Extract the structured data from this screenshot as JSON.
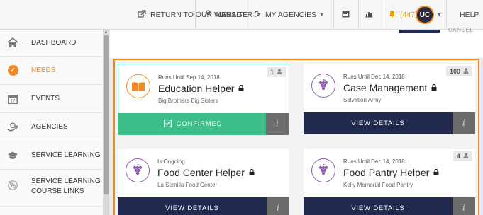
{
  "nav": {
    "return_label": "RETURN TO OUR WEBSITE",
    "manager_label": "MANAGER",
    "my_agencies_label": "MY AGENCIES",
    "alerts_label": "(447)",
    "user_initials": "UC",
    "help_label": "HELP"
  },
  "sidebar": {
    "items": [
      {
        "label": "DASHBOARD",
        "icon": "home-icon"
      },
      {
        "label": "NEEDS",
        "icon": "check-circle-icon",
        "active": true
      },
      {
        "label": "EVENTS",
        "icon": "calendar-icon",
        "day": "17"
      },
      {
        "label": "AGENCIES",
        "icon": "hands-icon"
      },
      {
        "label": "SERVICE LEARNING",
        "icon": "graduation-cap-icon"
      },
      {
        "label": "SERVICE LEARNING COURSE LINKS",
        "label_line1": "SERVICE LEARNING",
        "label_line2": "COURSE LINKS",
        "icon": "link-icon"
      }
    ]
  },
  "toolbar": {
    "cancel_label": "CANCEL"
  },
  "colors": {
    "accent": "#f08a25",
    "navy": "#22294f",
    "confirmed_green": "#3dbd8a",
    "purple": "#8e5da8"
  },
  "needs": [
    {
      "meta": "Runs Until Sep 14, 2018",
      "title": "Education Helper",
      "org": "Big Brothers Big Sisters",
      "count": "1",
      "icon": "book-icon",
      "action": "CONFIRMED",
      "status": "confirmed"
    },
    {
      "meta": "Runs Until Dec 14, 2018",
      "title": "Case Management",
      "org": "Salvation Army",
      "count": "100",
      "icon": "grapes-icon",
      "action": "VIEW DETAILS",
      "status": "open"
    },
    {
      "meta": "Is Ongoing",
      "title": "Food Center Helper",
      "org": "La Semilla Food Center",
      "count": "",
      "icon": "grapes-icon",
      "action": "VIEW DETAILS",
      "status": "open"
    },
    {
      "meta": "Runs Until Dec 14, 2018",
      "title": "Food Pantry Helper",
      "org": "Kelly Memorial Food Pantry",
      "count": "4",
      "icon": "grapes-icon",
      "action": "VIEW DETAILS",
      "status": "open"
    }
  ],
  "info_label": "i"
}
